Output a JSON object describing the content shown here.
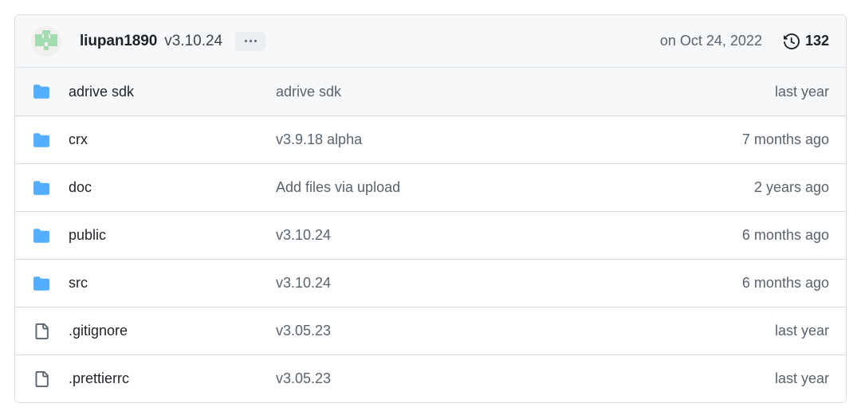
{
  "header": {
    "avatar_name": "identicon-avatar",
    "avatar_color": "#a2dcb0",
    "avatar_bg": "#f0f0ee",
    "author": "liupan1890",
    "commit_message": "v3.10.24",
    "ellipsis_label": "...",
    "commit_date": "on Oct 24, 2022",
    "history_icon": "history-icon",
    "commit_count": "132"
  },
  "rows": [
    {
      "type": "folder",
      "icon": "folder-icon",
      "name": "adrive sdk",
      "commit": "adrive sdk",
      "time": "last year",
      "highlighted": true
    },
    {
      "type": "folder",
      "icon": "folder-icon",
      "name": "crx",
      "commit": "v3.9.18 alpha",
      "time": "7 months ago",
      "highlighted": false
    },
    {
      "type": "folder",
      "icon": "folder-icon",
      "name": "doc",
      "commit": "Add files via upload",
      "time": "2 years ago",
      "highlighted": false
    },
    {
      "type": "folder",
      "icon": "folder-icon",
      "name": "public",
      "commit": "v3.10.24",
      "time": "6 months ago",
      "highlighted": false
    },
    {
      "type": "folder",
      "icon": "folder-icon",
      "name": "src",
      "commit": "v3.10.24",
      "time": "6 months ago",
      "highlighted": false
    },
    {
      "type": "file",
      "icon": "file-icon",
      "name": ".gitignore",
      "commit": "v3.05.23",
      "time": "last year",
      "highlighted": false
    },
    {
      "type": "file",
      "icon": "file-icon",
      "name": ".prettierrc",
      "commit": "v3.05.23",
      "time": "last year",
      "highlighted": false
    }
  ],
  "colors": {
    "folder_blue": "#54aeff",
    "file_gray": "#59636e",
    "border": "#d1d9e0",
    "header_bg": "#f6f8fa",
    "text_primary": "#1f2328",
    "text_muted": "#59636e"
  }
}
